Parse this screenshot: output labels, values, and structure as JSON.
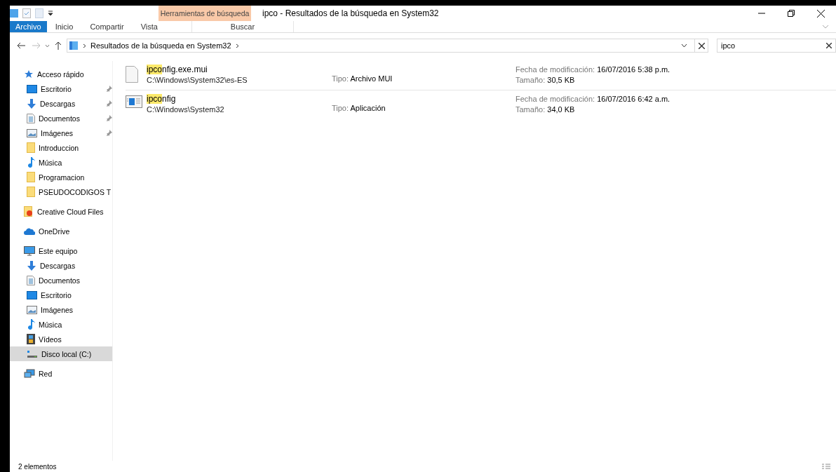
{
  "window": {
    "title": "ipco - Resultados de la búsqueda en System32",
    "context_tab": "Herramientas de búsqueda"
  },
  "ribbon_tabs": [
    {
      "label": "Archivo",
      "kind": "file",
      "selected": false
    },
    {
      "label": "Inicio",
      "kind": "tab",
      "selected": false
    },
    {
      "label": "Compartir",
      "kind": "tab",
      "selected": false
    },
    {
      "label": "Vista",
      "kind": "tab",
      "selected": false
    },
    {
      "label": "Buscar",
      "kind": "context",
      "selected": false
    }
  ],
  "address": {
    "crumb": "Resultados de la búsqueda en System32"
  },
  "search": {
    "value": "ipco"
  },
  "sidebar": [
    {
      "label": "Acceso rápido",
      "kind": "star",
      "selected": false,
      "children": [
        {
          "label": "Escritorio",
          "kind": "desktop",
          "pinned": true,
          "selected": false
        },
        {
          "label": "Descargas",
          "kind": "download",
          "pinned": true,
          "selected": false
        },
        {
          "label": "Documentos",
          "kind": "document",
          "pinned": true,
          "selected": false
        },
        {
          "label": "Imágenes",
          "kind": "images",
          "pinned": true,
          "selected": false
        },
        {
          "label": "Introduccion",
          "kind": "folder",
          "pinned": false,
          "selected": false
        },
        {
          "label": "Música",
          "kind": "music",
          "pinned": false,
          "selected": false
        },
        {
          "label": "Programacion",
          "kind": "folder",
          "pinned": false,
          "selected": false
        },
        {
          "label": "PSEUDOCODIGOS T",
          "kind": "folder",
          "pinned": false,
          "selected": false
        }
      ]
    },
    {
      "label": "Creative Cloud Files",
      "kind": "ccfolder",
      "selected": false
    },
    {
      "label": "OneDrive",
      "kind": "cloud",
      "selected": false
    },
    {
      "label": "Este equipo",
      "kind": "computer",
      "selected": false,
      "children": [
        {
          "label": "Descargas",
          "kind": "download",
          "pinned": false,
          "selected": false
        },
        {
          "label": "Documentos",
          "kind": "document",
          "pinned": false,
          "selected": false
        },
        {
          "label": "Escritorio",
          "kind": "desktop",
          "pinned": false,
          "selected": false
        },
        {
          "label": "Imágenes",
          "kind": "images",
          "pinned": false,
          "selected": false
        },
        {
          "label": "Música",
          "kind": "music",
          "pinned": false,
          "selected": false
        },
        {
          "label": "Vídeos",
          "kind": "video",
          "pinned": false,
          "selected": false
        },
        {
          "label": "Disco local (C:)",
          "kind": "drive",
          "pinned": false,
          "selected": true
        }
      ]
    },
    {
      "label": "Red",
      "kind": "network",
      "selected": false
    }
  ],
  "results": [
    {
      "kind": "file",
      "match": "ipco",
      "rest": "nfig.exe.mui",
      "path": "C:\\Windows\\System32\\es-ES",
      "type_label": "Tipo:",
      "type": "Archivo MUI",
      "date_label": "Fecha de modificación:",
      "date": "16/07/2016 5:38 p.m.",
      "size_label": "Tamaño:",
      "size": "30,5 KB"
    },
    {
      "kind": "app",
      "match": "ipco",
      "rest": "nfig",
      "path": "C:\\Windows\\System32",
      "type_label": "Tipo:",
      "type": "Aplicación",
      "date_label": "Fecha de modificación:",
      "date": "16/07/2016 6:42 a.m.",
      "size_label": "Tamaño:",
      "size": "34,0 KB"
    }
  ],
  "status_bar": {
    "count": "2 elementos"
  }
}
